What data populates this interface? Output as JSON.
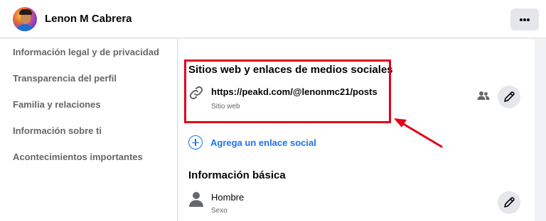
{
  "profile": {
    "name": "Lenon M Cabrera"
  },
  "header": {
    "more_icon": "more-horizontal-icon"
  },
  "sidebar": {
    "items": [
      {
        "label": "Información legal y de privacidad"
      },
      {
        "label": "Transparencia del perfil"
      },
      {
        "label": "Familia y relaciones"
      },
      {
        "label": "Información sobre ti"
      },
      {
        "label": "Acontecimientos importantes"
      }
    ]
  },
  "websites": {
    "title": "Sitios web y enlaces de medios sociales",
    "link": {
      "value": "https://peakd.com/@lenonmc21/posts",
      "type": "Sitio web",
      "icon": "link-icon",
      "audience_icon": "friends-icon"
    },
    "add_label": "Agrega un enlace social"
  },
  "basic_info": {
    "title": "Información básica",
    "gender": {
      "value": "Hombre",
      "type": "Sexo",
      "icon": "person-icon"
    }
  },
  "colors": {
    "accent": "#1b74e4",
    "highlight": "#e3001b"
  }
}
